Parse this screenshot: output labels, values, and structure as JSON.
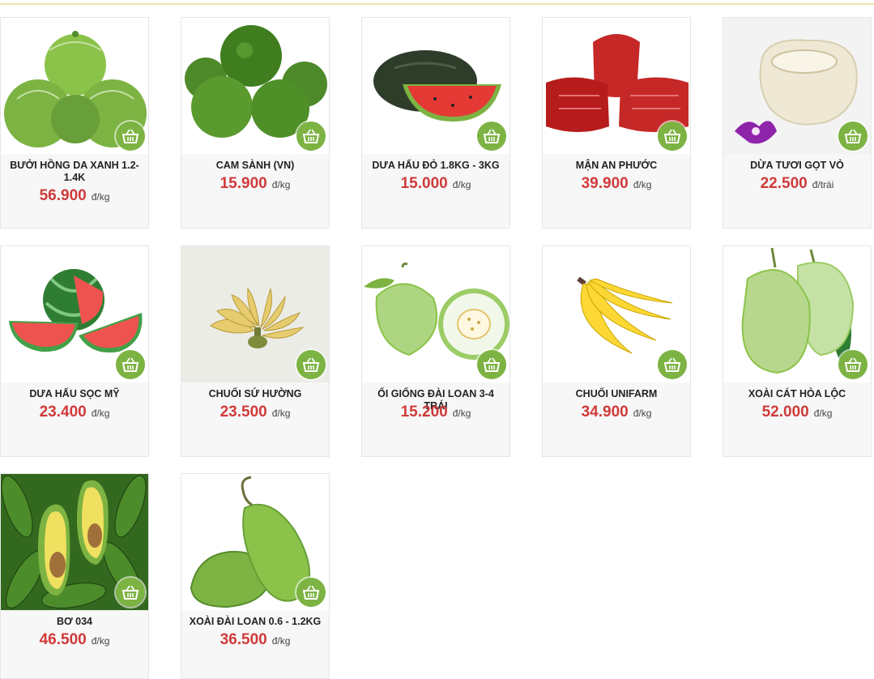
{
  "products": [
    {
      "name": "BƯỞI HỒNG DA XANH 1.2-1.4K",
      "price": "56.900",
      "unit": "đ/kg",
      "icon": "pomelo"
    },
    {
      "name": "CAM SÀNH (VN)",
      "price": "15.900",
      "unit": "đ/kg",
      "icon": "orange"
    },
    {
      "name": "DƯA HẤU ĐỎ 1.8KG - 3KG",
      "price": "15.000",
      "unit": "đ/kg",
      "icon": "watermelon"
    },
    {
      "name": "MẬN AN PHƯỚC",
      "price": "39.900",
      "unit": "đ/kg",
      "icon": "rose-apple"
    },
    {
      "name": "DỪA TƯƠI GỌT VỎ",
      "price": "22.500",
      "unit": "đ/trái",
      "icon": "coconut"
    },
    {
      "name": "DƯA HẤU SỌC MỸ",
      "price": "23.400",
      "unit": "đ/kg",
      "icon": "striped-watermelon"
    },
    {
      "name": "CHUỐI SỨ HƯỜNG",
      "price": "23.500",
      "unit": "đ/kg",
      "icon": "banana-bunch"
    },
    {
      "name": "ỔI GIỐNG ĐÀI LOAN 3-4 TRÁI",
      "price": "15.200",
      "unit": "đ/kg",
      "icon": "guava"
    },
    {
      "name": "CHUỐI UNIFARM",
      "price": "34.900",
      "unit": "đ/kg",
      "icon": "banana"
    },
    {
      "name": "XOÀI CÁT HÒA LỘC",
      "price": "52.000",
      "unit": "đ/kg",
      "icon": "mango"
    },
    {
      "name": "BƠ 034",
      "price": "46.500",
      "unit": "đ/kg",
      "icon": "avocado"
    },
    {
      "name": "XOÀI ĐÀI LOAN 0.6 - 1.2KG",
      "price": "36.500",
      "unit": "đ/kg",
      "icon": "green-mango"
    }
  ],
  "colors": {
    "price": "#d03a3a",
    "cart": "#7cb342"
  }
}
